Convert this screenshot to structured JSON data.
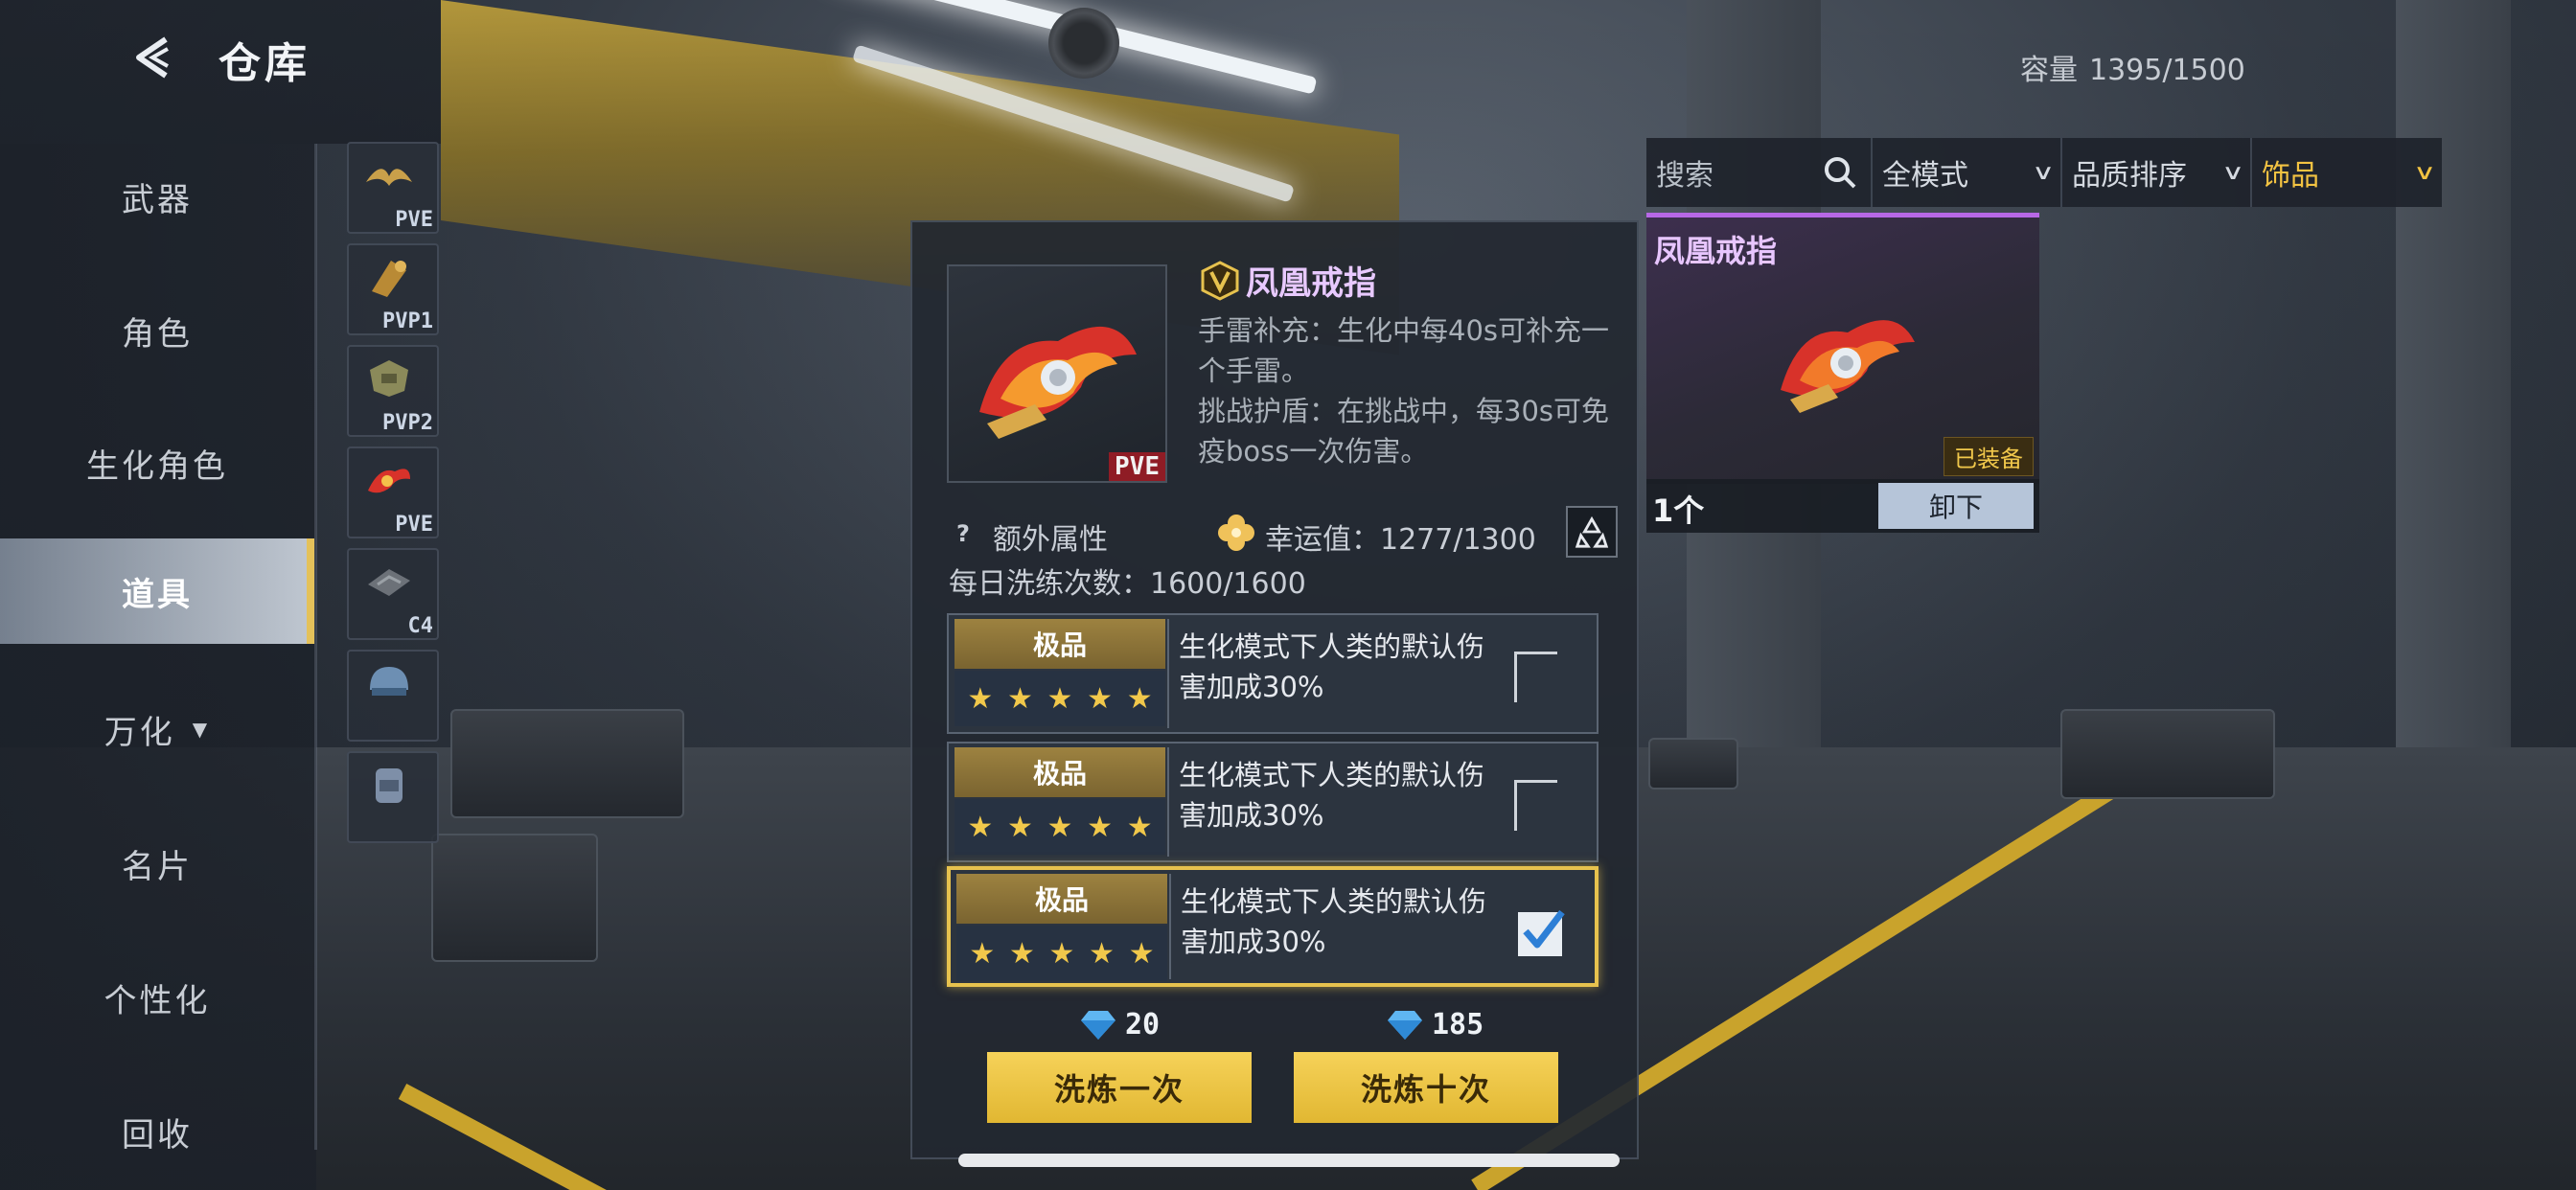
{
  "header": {
    "title": "仓库"
  },
  "capacity": {
    "label": "容量",
    "value": "1395/1500"
  },
  "nav": {
    "items": [
      {
        "label": "武器"
      },
      {
        "label": "角色"
      },
      {
        "label": "生化角色"
      },
      {
        "label": "道具",
        "active": true
      },
      {
        "label": "万化",
        "caret": "▼"
      },
      {
        "label": "名片"
      },
      {
        "label": "个性化"
      },
      {
        "label": "回收"
      }
    ]
  },
  "thumbs": [
    "PVE",
    "PVP1",
    "PVP2",
    "PVE",
    "C4",
    "",
    ""
  ],
  "filter": {
    "search_placeholder": "搜索",
    "mode": "全模式",
    "sort": "品质排序",
    "category": "饰品"
  },
  "equipped": {
    "name": "凤凰戒指",
    "badge": "已装备",
    "count": "1个",
    "unequip_label": "卸下"
  },
  "item": {
    "name": "凤凰戒指",
    "mode_tag": "PVE",
    "desc_1": "手雷补充：生化中每40s可补充一个手雷。",
    "desc_2": "挑战护盾：在挑战中，每30s可免疫boss一次伤害。",
    "extra_attr_label": "额外属性",
    "luck_label": "幸运值：1277/1300",
    "daily_label": "每日洗练次数：1600/1600"
  },
  "options": [
    {
      "grade": "极品",
      "text": "生化模式下人类的默认伤害加成30%",
      "selected": false
    },
    {
      "grade": "极品",
      "text": "生化模式下人类的默认伤害加成30%",
      "selected": false
    },
    {
      "grade": "极品",
      "text": "生化模式下人类的默认伤害加成30%",
      "selected": true
    }
  ],
  "star_glyph": "★",
  "refine": {
    "once": {
      "cost": "20",
      "label": "洗炼一次"
    },
    "ten": {
      "cost": "185",
      "label": "洗炼十次"
    }
  },
  "colors": {
    "accent_gold": "#e7c24e",
    "item_purple": "#e8c9ff",
    "pve_red": "#8f1c25"
  }
}
